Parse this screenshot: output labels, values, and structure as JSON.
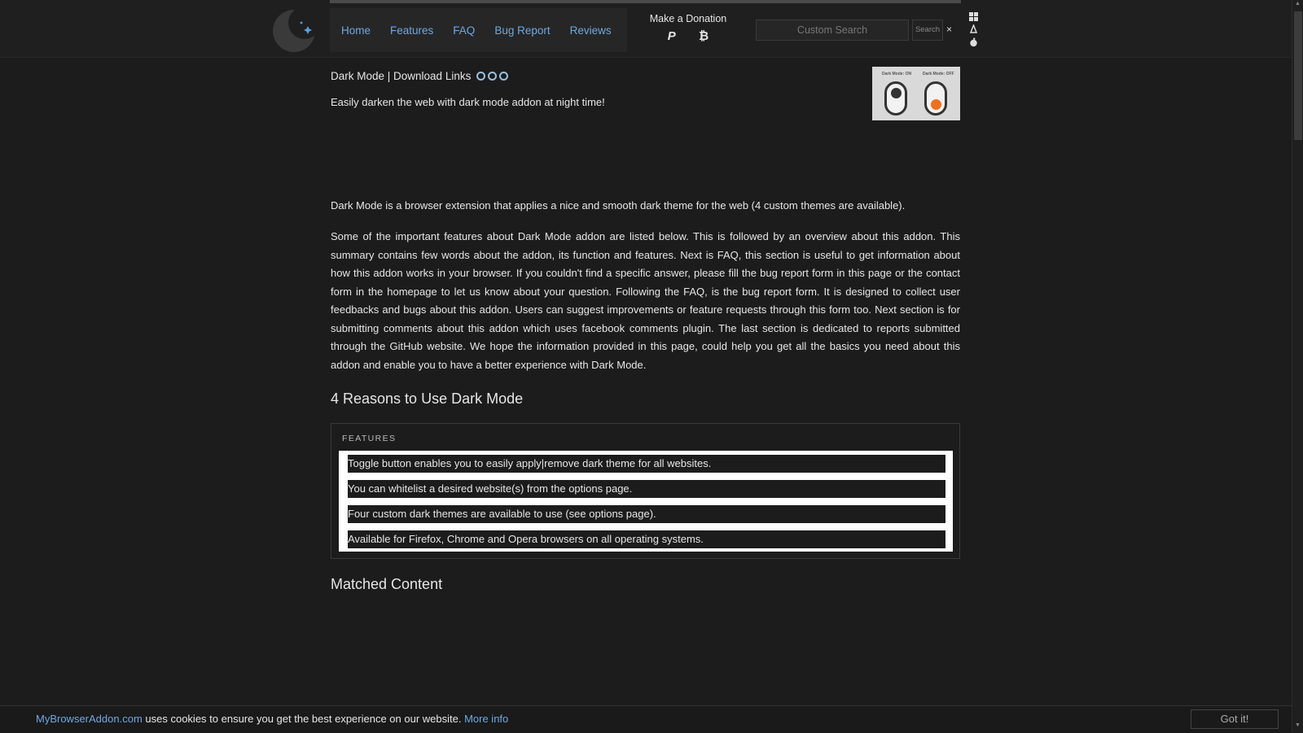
{
  "nav": {
    "items": [
      {
        "label": "Home"
      },
      {
        "label": "Features"
      },
      {
        "label": "FAQ"
      },
      {
        "label": "Bug Report"
      },
      {
        "label": "Reviews"
      }
    ]
  },
  "donation": {
    "label": "Make a Donation",
    "paypal_glyph": "P",
    "bitcoin_glyph": "₿"
  },
  "search": {
    "placeholder": "Custom Search",
    "button_label": "Search",
    "clear_glyph": "×"
  },
  "os_icons": [
    "windows-icon",
    "linux-icon",
    "apple-icon"
  ],
  "main": {
    "title": "Dark Mode | Download Links",
    "download_icons": [
      "firefox-icon",
      "chrome-icon",
      "opera-icon"
    ],
    "tagline": "Easily darken the web with dark mode addon at night time!",
    "thumbnail": {
      "label_on": "Dark Mode: ON",
      "label_off": "Dark Mode: OFF"
    },
    "intro": "Dark Mode is a browser extension that applies a nice and smooth dark theme for the web (4 custom themes are available).",
    "overview": "Some of the important features about Dark Mode addon are listed below. This is followed by an overview about this addon. This summary contains few words about the addon, its function and features. Next is FAQ, this section is useful to get information about how this addon works in your browser. If you couldn't find a specific answer, please fill the bug report form in this page or the contact form in the homepage to let us know about your question. Following the FAQ, is the bug report form. It is designed to collect user feedbacks and bugs about this addon. Users can suggest improvements or feature requests through this form too. Next section is for submitting comments about this addon which uses facebook comments plugin. The last section is dedicated to reports submitted through the GitHub website. We hope the information provided in this page, could help you get all the basics you need about this addon and enable you to have a better experience with Dark Mode.",
    "reasons_heading": "4 Reasons to Use Dark Mode",
    "features_caption": "FEATURES",
    "features": [
      "Toggle button enables you to easily apply|remove dark theme for all websites.",
      "You can whitelist a desired website(s) from the options page.",
      "Four custom dark themes are available to use (see options page).",
      "Available for Firefox, Chrome and Opera browsers on all operating systems."
    ],
    "matched_heading": "Matched Content"
  },
  "cookie": {
    "site": "MyBrowserAddon.com",
    "text": " uses cookies to ensure you get the best experience on our website. ",
    "more": "More info",
    "button": "Got it!"
  },
  "colors": {
    "background": "#1c1c1c",
    "link": "#6ea8e0",
    "accent_orange": "#f07020"
  }
}
